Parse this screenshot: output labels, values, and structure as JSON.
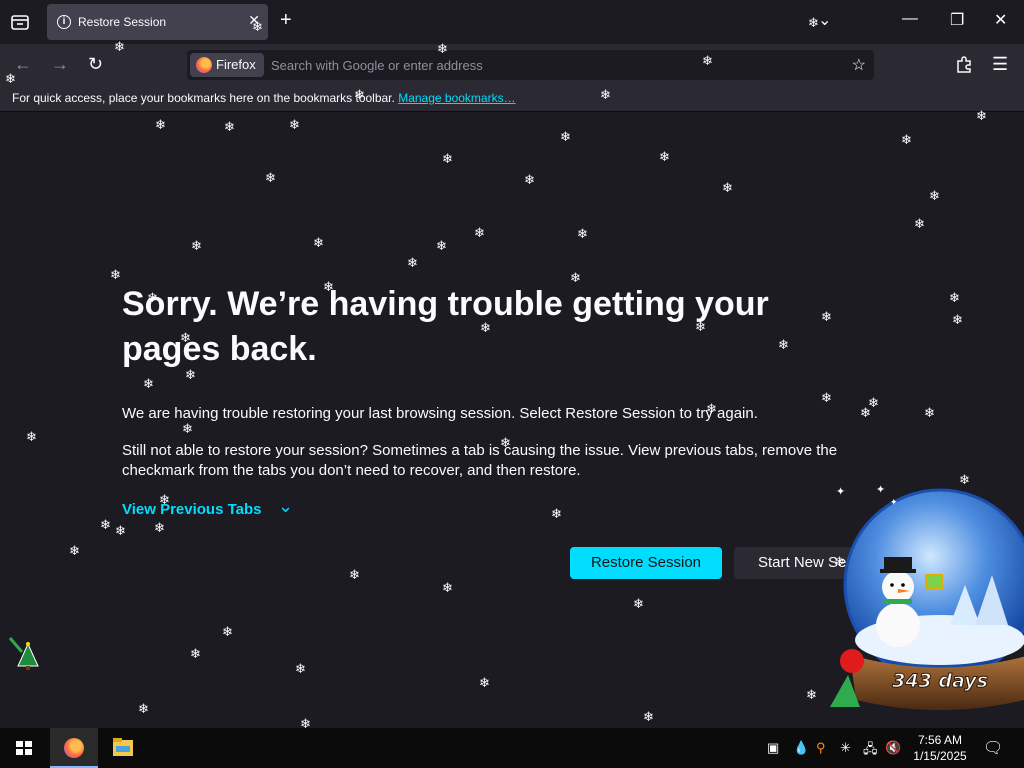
{
  "tab": {
    "title": "Restore Session"
  },
  "urlbar": {
    "identity_label": "Firefox",
    "placeholder": "Search with Google or enter address"
  },
  "bookmarks_toolbar": {
    "message": "For quick access, place your bookmarks here on the bookmarks toolbar.",
    "manage_link": "Manage bookmarks…"
  },
  "error_page": {
    "title": "Sorry. We’re having trouble getting your pages back.",
    "description": "We are having trouble restoring your last browsing session. Select Restore Session to try again.",
    "help": "Still not able to restore your session? Sometimes a tab is causing the issue. View previous tabs, remove the checkmark from the tabs you don’t need to recover, and then restore.",
    "view_previous_tabs": "View Previous Tabs",
    "restore_button": "Restore Session",
    "start_new_button": "Start New Session"
  },
  "snow_globe": {
    "days_label": "343 days"
  },
  "taskbar": {
    "time": "7:56 AM",
    "date": "1/15/2025"
  },
  "colors": {
    "accent": "#00ddff",
    "background": "#1c1b22",
    "toolbar": "#2b2a33"
  }
}
